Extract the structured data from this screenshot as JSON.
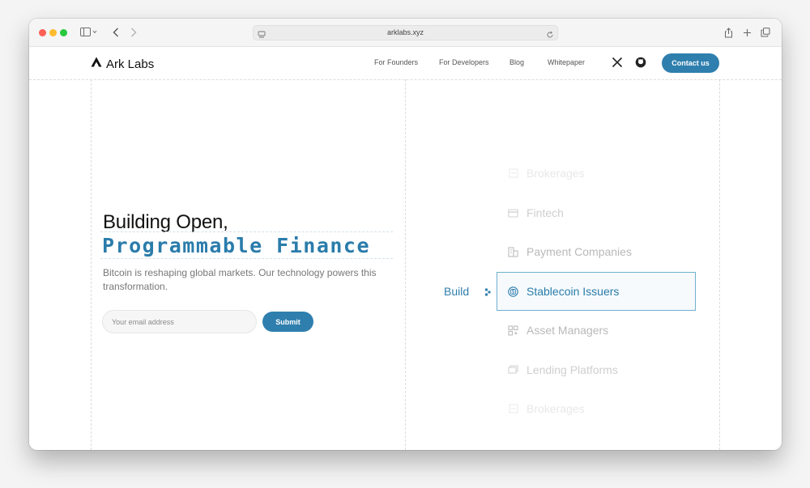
{
  "browser": {
    "url": "arklabs.xyz"
  },
  "header": {
    "logo_text": "Ark Labs",
    "nav": [
      {
        "label": "For Founders"
      },
      {
        "label": "For Developers"
      },
      {
        "label": "Blog"
      },
      {
        "label": "Whitepaper"
      }
    ],
    "social_icons": [
      "x-icon",
      "github-icon"
    ],
    "contact_label": "Contact us"
  },
  "hero": {
    "title_line1": "Building Open,",
    "title_line2": "Programmable Finance",
    "subtitle": "Bitcoin is reshaping global markets. Our technology powers this transformation.",
    "email_placeholder": "Your email address",
    "submit_label": "Submit"
  },
  "build": {
    "label": "Build",
    "items": [
      {
        "label": "Brokerages",
        "icon": "brokerage-icon"
      },
      {
        "label": "Fintech",
        "icon": "credit-card-icon"
      },
      {
        "label": "Payment Companies",
        "icon": "building-icon"
      },
      {
        "label": "Stablecoin Issuers",
        "icon": "dollar-coin-icon"
      },
      {
        "label": "Asset Managers",
        "icon": "grid-icon"
      },
      {
        "label": "Lending Platforms",
        "icon": "stack-icon"
      },
      {
        "label": "Brokerages",
        "icon": "brokerage-icon"
      }
    ],
    "active_index": 3
  },
  "colors": {
    "accent": "#2f7fae",
    "text": "#111111",
    "muted": "#777777"
  }
}
